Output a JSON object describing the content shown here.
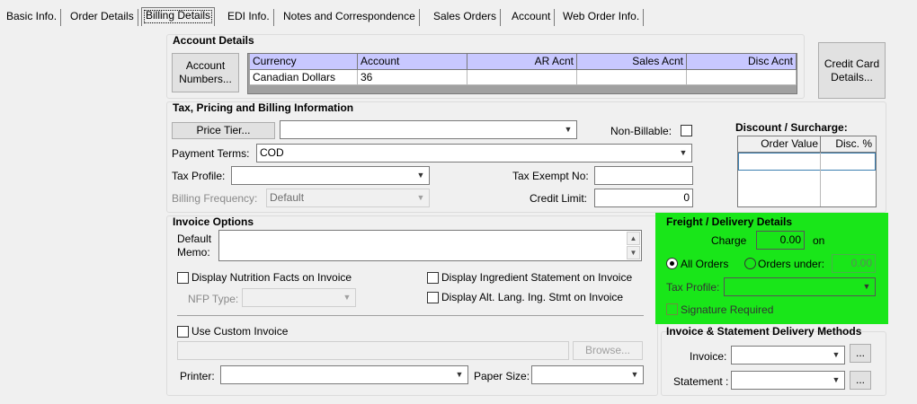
{
  "tabs": [
    {
      "label": "Basic Info."
    },
    {
      "label": "Order Details"
    },
    {
      "label": "Billing Details"
    },
    {
      "label": "EDI Info."
    },
    {
      "label": "Notes and Correspondence"
    },
    {
      "label": "Sales Orders"
    },
    {
      "label": "Account"
    },
    {
      "label": "Web Order Info."
    }
  ],
  "account_details": {
    "title": "Account Details",
    "account_numbers_button": "Account Numbers...",
    "columns": [
      "Currency",
      "Account",
      "AR Acnt",
      "Sales Acnt",
      "Disc Acnt"
    ],
    "rows": [
      [
        "Canadian Dollars",
        "36",
        "",
        "",
        ""
      ]
    ]
  },
  "credit_card_button": "Credit Card Details...",
  "tax_pricing": {
    "title": "Tax, Pricing and Billing Information",
    "price_tier_button": "Price Tier...",
    "price_tier_value": "",
    "non_billable_label": "Non-Billable:",
    "payment_terms_label": "Payment Terms:",
    "payment_terms_value": "COD",
    "tax_profile_label": "Tax Profile:",
    "tax_profile_value": "",
    "tax_exempt_label": "Tax Exempt No:",
    "tax_exempt_value": "",
    "billing_frequency_label": "Billing Frequency:",
    "billing_frequency_value": "Default",
    "credit_limit_label": "Credit Limit:",
    "credit_limit_value": "0"
  },
  "discount": {
    "title": "Discount / Surcharge:",
    "columns": [
      "Order Value",
      "Disc. %"
    ]
  },
  "invoice_options": {
    "title": "Invoice Options",
    "default_memo_label_1": "Default",
    "default_memo_label_2": "Memo:",
    "nutrition_facts_label": "Display Nutrition Facts on Invoice",
    "ingredient_statement_label": "Display Ingredient Statement on Invoice",
    "nfp_type_label": "NFP Type:",
    "alt_lang_label": "Display Alt. Lang. Ing. Stmt on Invoice",
    "custom_invoice_label": "Use Custom Invoice",
    "browse_button": "Browse...",
    "printer_label": "Printer:",
    "paper_size_label": "Paper Size:"
  },
  "freight": {
    "title": "Freight / Delivery Details",
    "charge_label": "Charge",
    "charge_value": "0.00",
    "on_label": "on",
    "all_orders_label": "All Orders",
    "orders_under_label": "Orders under:",
    "orders_under_value": "0.00",
    "tax_profile_label": "Tax Profile:",
    "signature_label": "Signature Required"
  },
  "delivery_methods": {
    "title": "Invoice & Statement Delivery Methods",
    "invoice_label": "Invoice:",
    "statement_label": "Statement :",
    "ellipsis": "..."
  },
  "colors": {
    "grid_header": "#c8c8ff",
    "freight_highlight": "#19e619"
  }
}
